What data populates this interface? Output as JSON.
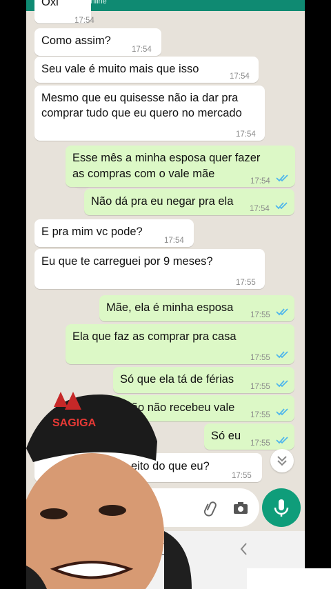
{
  "header": {
    "status": "Online",
    "first_time": "17:54"
  },
  "first_partial": "Oxi",
  "messages": [
    {
      "text": "Como assim?",
      "time": "17:54",
      "dir": "in"
    },
    {
      "text": "Seu vale é muito mais que isso",
      "time": "17:54",
      "dir": "in"
    },
    {
      "text1": "Mesmo que eu quisesse não ia dar pra",
      "text2": "comprar tudo que eu quero no mercado",
      "time": "17:54",
      "dir": "in"
    },
    {
      "text1": "Esse mês a minha esposa quer fazer",
      "text2": "as compras com o vale mãe",
      "time": "17:54",
      "dir": "out"
    },
    {
      "text": "Não dá pra eu negar pra ela",
      "time": "17:54",
      "dir": "out"
    },
    {
      "text": "E pra mim vc pode?",
      "time": "17:54",
      "dir": "in"
    },
    {
      "text": "Eu que te carreguei por 9 meses?",
      "time": "17:55",
      "dir": "in"
    },
    {
      "text": "Mãe, ela é minha esposa",
      "time": "17:55",
      "dir": "out"
    },
    {
      "text": "Ela que faz as comprar pra casa",
      "time": "17:55",
      "dir": "out"
    },
    {
      "text": "Só que ela tá de férias",
      "time": "17:55",
      "dir": "out"
    },
    {
      "text": "Então não recebeu vale",
      "time": "17:55",
      "dir": "out"
    },
    {
      "text": "Só eu",
      "time": "17:55",
      "dir": "out"
    },
    {
      "text": "eito do que eu?",
      "time": "17:55",
      "dir": "in"
    }
  ],
  "overlay": {
    "cap_text": "SAGIGA"
  },
  "colors": {
    "header": "#0f8a72",
    "out_bubble": "#dcf8c6",
    "in_bubble": "#ffffff",
    "tick_blue": "#4fb6ec",
    "mic": "#0f9d7a"
  },
  "icons": {
    "attach": "paperclip-icon",
    "camera": "camera-icon",
    "mic": "microphone-icon",
    "scroll": "chevron-down-icon",
    "nav_home": "home-icon",
    "nav_back": "back-icon"
  }
}
